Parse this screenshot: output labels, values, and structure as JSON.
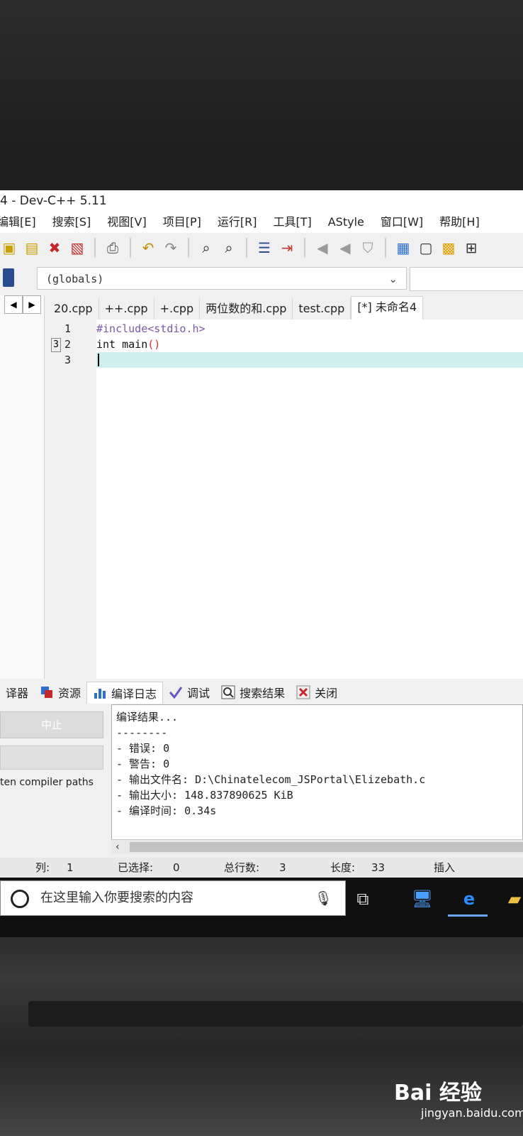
{
  "window": {
    "title": "4 - Dev-C++ 5.11"
  },
  "menu": [
    "编辑[E]",
    "搜索[S]",
    "视图[V]",
    "项目[P]",
    "运行[R]",
    "工具[T]",
    "AStyle",
    "窗口[W]",
    "帮助[H]"
  ],
  "class_browser": {
    "scope": "(globals)"
  },
  "tabs": [
    "20.cpp",
    "++.cpp",
    "+.cpp",
    "两位数的和.cpp",
    "test.cpp",
    "[*] 未命名4"
  ],
  "editor": {
    "line_numbers": [
      "1",
      "2",
      "3"
    ],
    "breakpoint_marker": "3",
    "lines": [
      {
        "text": "#include<stdio.h>",
        "color": "#7a5aa8"
      },
      {
        "text": "int main()",
        "color": "#111111"
      }
    ],
    "paren_color": "#e03030"
  },
  "bottom_tabs": [
    "译器",
    "资源",
    "编译日志",
    "调试",
    "搜索结果",
    "关闭"
  ],
  "bottom_panel": {
    "stop_button": "中止",
    "paths_label": "ten compiler paths"
  },
  "compile_log": [
    "编译结果...",
    "--------",
    "- 错误: 0",
    "- 警告: 0",
    "- 输出文件名: D:\\Chinatelecom_JSPortal\\Elizebath.c",
    "- 输出大小: 148.837890625 KiB",
    "- 编译时间: 0.34s"
  ],
  "statusbar": {
    "col_label": "列:",
    "col_value": "1",
    "sel_label": "已选择:",
    "sel_value": "0",
    "lines_label": "总行数:",
    "lines_value": "3",
    "len_label": "长度:",
    "len_value": "33",
    "mode": "插入"
  },
  "taskbar": {
    "search_placeholder": "在这里输入你要搜索的内容"
  },
  "watermark": {
    "brand": "Bai 经验",
    "url": "jingyan.baidu.com"
  }
}
